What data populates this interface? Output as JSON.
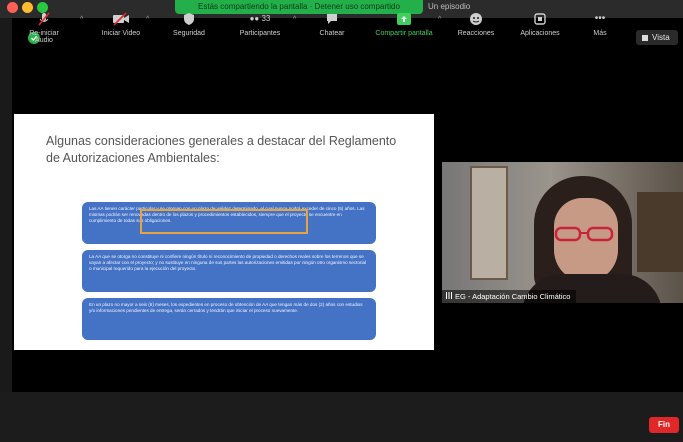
{
  "window": {
    "share_banner": "Estás compartiendo la pantalla · Detener uso compartido",
    "share_tail": "Un episodio",
    "vista_label": "Vista",
    "colors": {
      "close": "#ff5f57",
      "minimize": "#febc2e",
      "maximize": "#28c840"
    }
  },
  "slide": {
    "title": "Algunas consideraciones generales a destacar del Reglamento de Autorizaciones Ambientales:",
    "boxes": [
      "Las AA tienen carácter particular y se otorgan con un plazo de validez determinado, el cual nunca podrá exceder de cinco (5) años. Las mismas podrán ser renovadas dentro de los plazos y procedimientos establecidos, siempre que el proyecto se encuentre en cumplimiento de todas sus obligaciones.",
      "La AA que se otorga no constituye ni confiere ningún título ni reconocimiento de propiedad o derechos reales sobre los terrenos que se vayan a afectar con el proyecto; y no sustituye en ninguna de sus partes las autorizaciones emitidas por ningún otro organismo sectorial o municipal requerido para la ejecución del proyecto.",
      "En un plazo no mayor a seis (6) meses, los expedientes en proceso de obtención de AA que tengan más de dos (2) años con estudios y/o informaciones pendientes de entrega, serán cerrados y tendrán que iniciar el proceso nuevamente."
    ]
  },
  "participant": {
    "name_label": "EG - Adaptación Cambio Climático"
  },
  "toolbar": {
    "reiniciar_audio": "Re-iniciar Audio",
    "iniciar_video": "Iniciar Video",
    "seguridad": "Seguridad",
    "participantes": "Participantes",
    "participantes_count": "33",
    "chatear": "Chatear",
    "compartir_pantalla": "Compartir pantalla",
    "reacciones": "Reacciones",
    "aplicaciones": "Aplicaciones",
    "mas": "Más",
    "fin": "Fin"
  }
}
